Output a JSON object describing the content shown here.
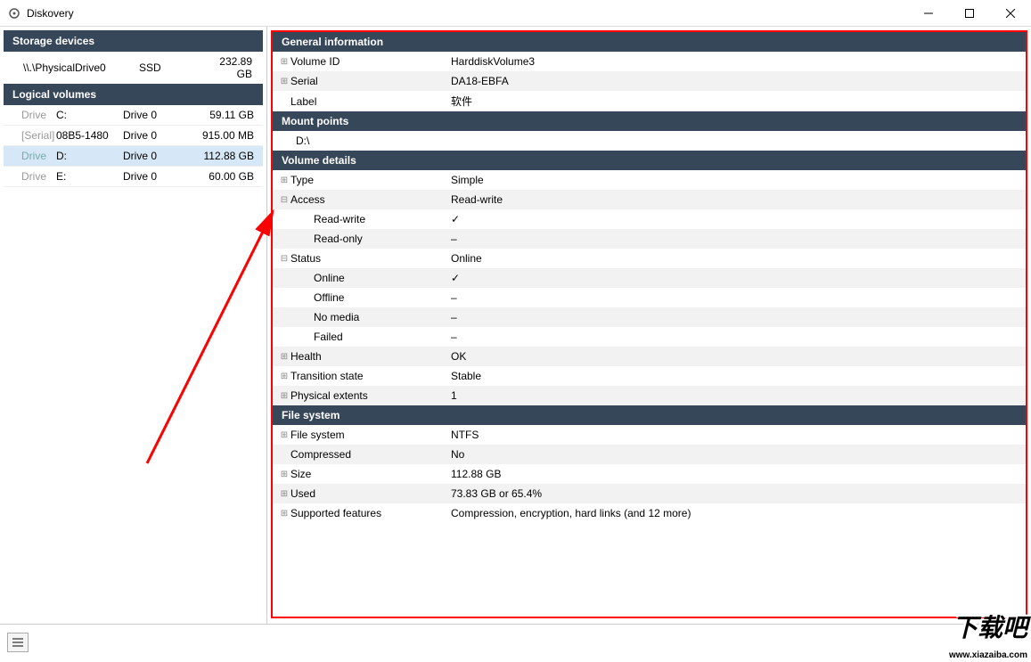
{
  "app": {
    "title": "Diskovery"
  },
  "storage": {
    "header": "Storage devices",
    "device": {
      "name": "\\\\.\\PhysicalDrive0",
      "type": "SSD",
      "size": "232.89 GB"
    }
  },
  "volumes": {
    "header": "Logical volumes",
    "items": [
      {
        "label": "Drive",
        "letter": "C:",
        "drive": "Drive 0",
        "size": "59.11 GB",
        "selected": false
      },
      {
        "label": "[Serial]",
        "letter": "08B5-1480",
        "drive": "Drive 0",
        "size": "915.00 MB",
        "selected": false
      },
      {
        "label": "Drive",
        "letter": "D:",
        "drive": "Drive 0",
        "size": "112.88 GB",
        "selected": true
      },
      {
        "label": "Drive",
        "letter": "E:",
        "drive": "Drive 0",
        "size": "60.00 GB",
        "selected": false
      }
    ]
  },
  "details": {
    "general": {
      "header": "General information",
      "volume_id_k": "Volume ID",
      "volume_id_v": "HarddiskVolume3",
      "serial_k": "Serial",
      "serial_v": "DA18-EBFA",
      "label_k": "Label",
      "label_v": "软件"
    },
    "mount": {
      "header": "Mount points",
      "path": "D:\\"
    },
    "vol": {
      "header": "Volume details",
      "type_k": "Type",
      "type_v": "Simple",
      "access_k": "Access",
      "access_v": "Read-write",
      "rw_k": "Read-write",
      "rw_v": "✓",
      "ro_k": "Read-only",
      "ro_v": "–",
      "status_k": "Status",
      "status_v": "Online",
      "online_k": "Online",
      "online_v": "✓",
      "offline_k": "Offline",
      "offline_v": "–",
      "nomedia_k": "No media",
      "nomedia_v": "–",
      "failed_k": "Failed",
      "failed_v": "–",
      "health_k": "Health",
      "health_v": "OK",
      "trans_k": "Transition state",
      "trans_v": "Stable",
      "ext_k": "Physical extents",
      "ext_v": "1"
    },
    "fs": {
      "header": "File system",
      "fs_k": "File system",
      "fs_v": "NTFS",
      "comp_k": "Compressed",
      "comp_v": "No",
      "size_k": "Size",
      "size_v": "112.88 GB",
      "used_k": "Used",
      "used_v": "73.83 GB  or  65.4%",
      "feat_k": "Supported features",
      "feat_v": "Compression, encryption, hard links (and 12 more)"
    }
  },
  "watermark": {
    "big": "下载吧",
    "url": "www.xiazaiba.com"
  }
}
